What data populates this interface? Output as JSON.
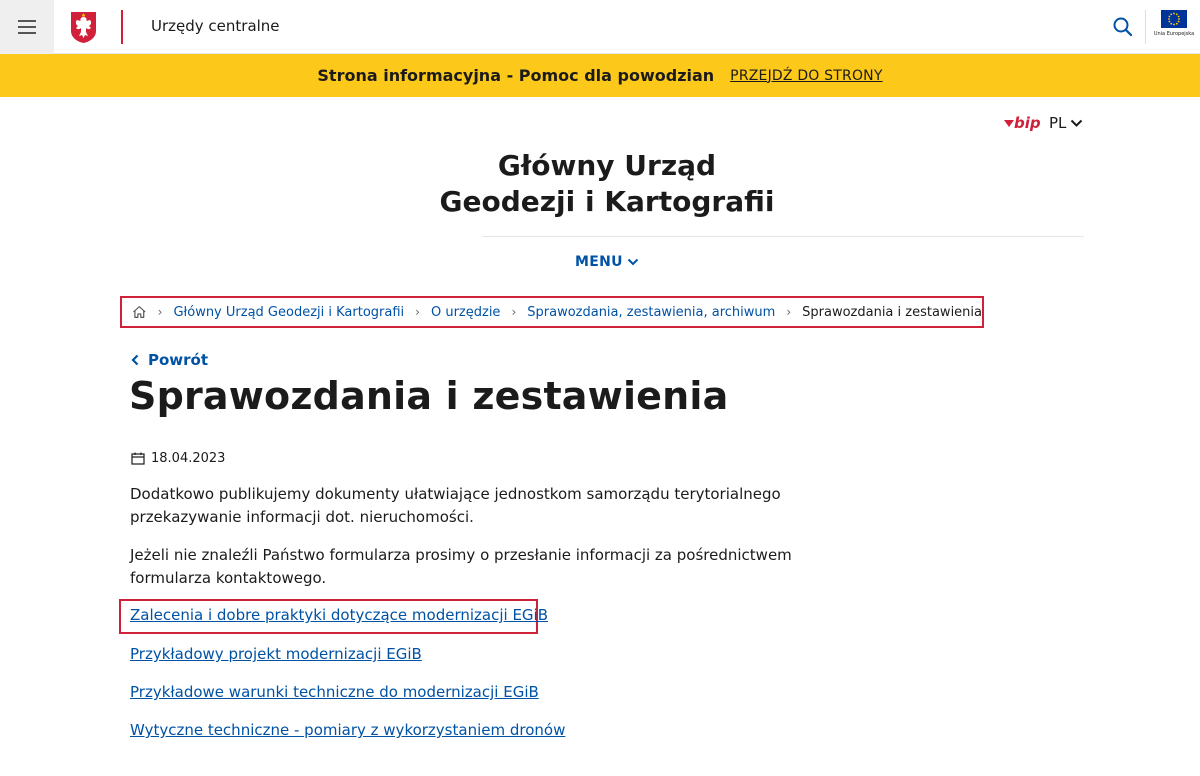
{
  "header": {
    "site_name": "Urzędy centralne",
    "eu_label": "Unia Europejska"
  },
  "banner": {
    "text": "Strona informacyjna - Pomoc dla powodzian",
    "link": "PRZEJDŹ DO STRONY",
    "color": "#fcc819"
  },
  "bip": {
    "label": "bip"
  },
  "language": {
    "selected": "PL"
  },
  "institution": {
    "title_line1": "Główny Urząd",
    "title_line2": "Geodezji i Kartografii"
  },
  "nav": {
    "menu_label": "MENU"
  },
  "breadcrumb": {
    "items": [
      "Główny Urząd Geodezji i Kartografii",
      "O urzędzie",
      "Sprawozdania, zestawienia, archiwum"
    ],
    "current": "Sprawozdania i zestawienia"
  },
  "page": {
    "back_label": "Powrót",
    "title": "Sprawozdania i zestawienia",
    "date": "18.04.2023",
    "paragraphs": [
      "Dodatkowo publikujemy dokumenty ułatwiające jednostkom samorządu terytorialnego przekazywanie informacji dot. nieruchomości.",
      "Jeżeli nie znaleźli Państwo formularza prosimy o przesłanie informacji za pośrednictwem formularza kontaktowego."
    ],
    "links": [
      "Zalecenia i dobre praktyki dotyczące modernizacji EGiB",
      "Przykładowy projekt modernizacji EGiB",
      "Przykładowe warunki techniczne do modernizacji EGiB",
      "Wytyczne techniczne - pomiary z wykorzystaniem dronów"
    ]
  },
  "colors": {
    "accent_red": "#d1213a",
    "link_blue": "#0052a5",
    "eu_blue": "#003399"
  }
}
